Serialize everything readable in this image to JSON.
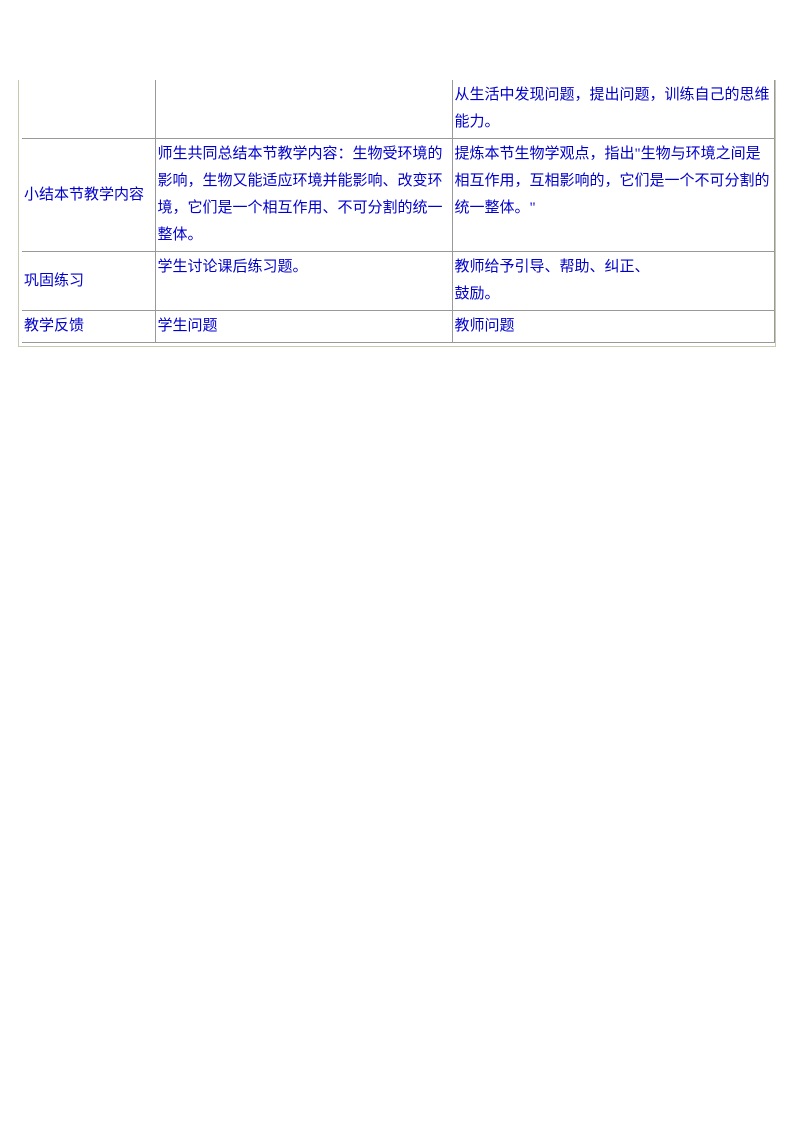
{
  "table": {
    "row0": {
      "col1": "",
      "col2": "",
      "col3": "从生活中发现问题，提出问题，训练自己的思维能力。"
    },
    "row1": {
      "col1": "小结本节教学内容",
      "col2": "师生共同总结本节教学内容：生物受环境的影响，生物又能适应环境并能影响、改变环境，它们是一个相互作用、不可分割的统一整体。",
      "col3": "提炼本节生物学观点，指出\"生物与环境之间是相互作用，互相影响的，它们是一个不可分割的统一整体。\""
    },
    "row2": {
      "col1": "巩固练习",
      "col2": "学生讨论课后练习题。",
      "col3_line1": "教师给予引导、帮助、纠正、",
      "col3_line2": "鼓励。"
    },
    "row3": {
      "col1": "教学反馈",
      "col2": "学生问题",
      "col3": "教师问题"
    }
  }
}
